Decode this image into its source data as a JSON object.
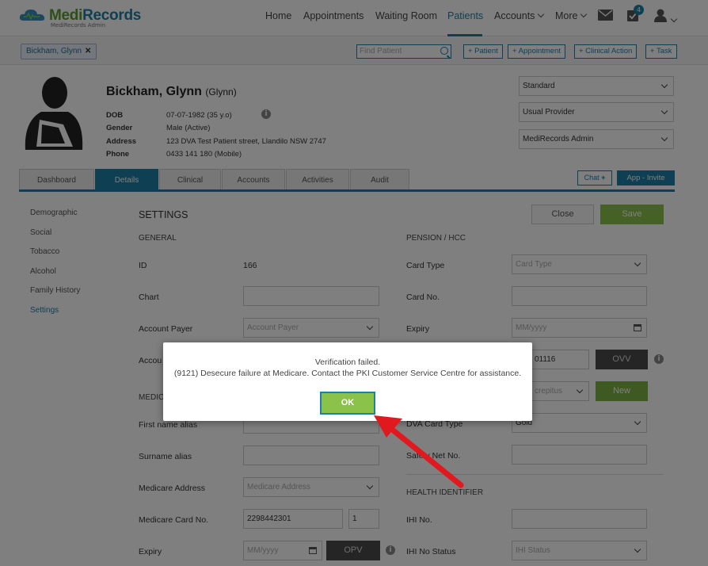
{
  "brand": {
    "name_a": "Medi",
    "name_b": "Records",
    "sub": "MediRecords Admin"
  },
  "nav": {
    "items": [
      "Home",
      "Appointments",
      "Waiting Room",
      "Patients",
      "Accounts",
      "More"
    ],
    "tasks_badge": "4"
  },
  "subbar": {
    "patient_tag": "Bickham, Glynn",
    "find_placeholder": "Find Patient",
    "buttons": [
      "+ Patient",
      "+ Appointment",
      "+ Clinical Action",
      "+ Task"
    ]
  },
  "patient": {
    "name": "Bickham, Glynn",
    "alias": "(Glynn)",
    "labels": [
      "DOB",
      "Gender",
      "Address",
      "Phone"
    ],
    "values": [
      "07-07-1982 (35 y.o)",
      "Male (Active)",
      "123 DVA Test Patient street, Llandilo NSW 2747",
      "0433 141 180 (Mobile)"
    ]
  },
  "header_selects": [
    "Standard",
    "Usual Provider",
    "MediRecords Admin"
  ],
  "tabs": [
    "Dashboard",
    "Details",
    "Clinical",
    "Accounts",
    "Activities",
    "Audit"
  ],
  "chat_label": "Chat",
  "invite_label": "App - Invite",
  "sidebar": [
    "Demographic",
    "Social",
    "Tobacco",
    "Alcohol",
    "Family History",
    "Settings"
  ],
  "settings": {
    "title": "SETTINGS",
    "close": "Close",
    "save": "Save",
    "general": "GENERAL",
    "medicare_head_partial": "MEDIC",
    "id_label": "ID",
    "id_value": "166",
    "chart_label": "Chart",
    "account_payer_label": "Account Payer",
    "account_payer_placeholder": "Account Payer",
    "account_partial": "Accou",
    "first_alias": "First name alias",
    "surname_alias": "Surname alias",
    "medicare_address": "Medicare Address",
    "medicare_address_placeholder": "Medicare Address",
    "medicare_card": "Medicare Card No.",
    "medicare_card_value": "2298442301",
    "medicare_irn": "1",
    "expiry_label": "Expiry",
    "expiry_placeholder": "MM/yyyy",
    "opv": "OPV",
    "pension_head": "PENSION / HCC",
    "card_type_label": "Card Type",
    "card_type_placeholder": "Card Type",
    "card_no_label": "Card No.",
    "expiry2_label": "Expiry",
    "expiry2_placeholder": "MM/yyyy",
    "dva_partial_value": "01116",
    "ovv": "OVV",
    "crepitus": "crepitus",
    "new": "New",
    "dva_card_type": "DVA Card Type",
    "dva_card_value": "Gold",
    "safety_net": "Safety Net No.",
    "health_head": "HEALTH IDENTIFIER",
    "ihi_no": "IHI No.",
    "ihi_status": "IHI No Status",
    "ihi_status_placeholder": "IHI Status"
  },
  "modal": {
    "line1": "Verification failed.",
    "line2": "(9121) Desecure failure at Medicare. Contact the PKI Customer Service Centre for assistance.",
    "ok": "OK"
  },
  "colors": {
    "brand_green": "#5a9e2f",
    "brand_blue": "#1f7fa6",
    "ok_green": "#8bc34a",
    "arrow_red": "#e0191f"
  }
}
